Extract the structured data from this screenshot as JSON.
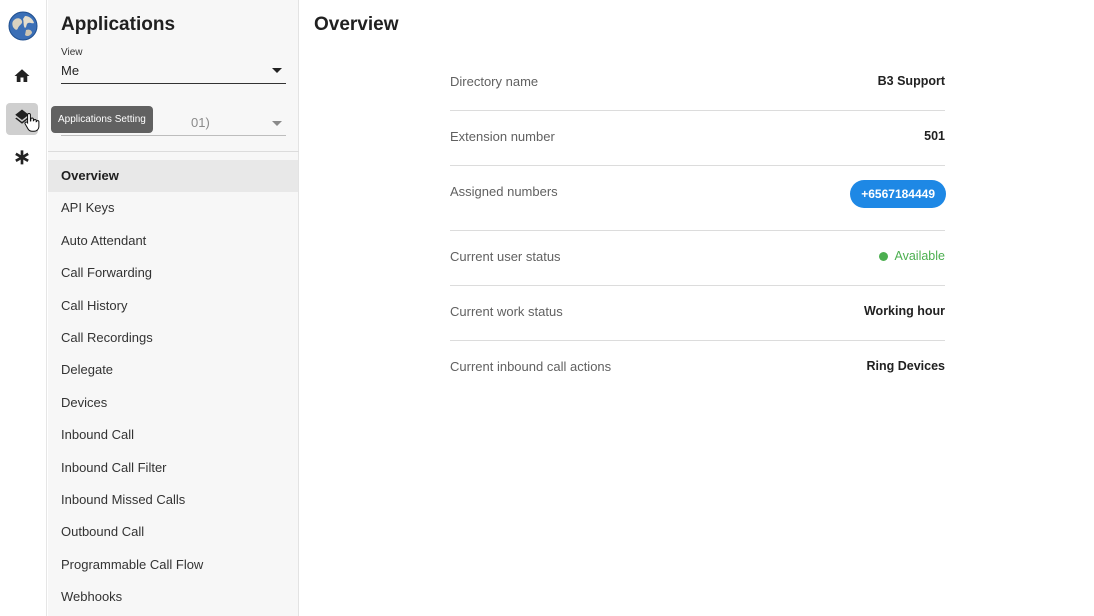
{
  "tooltip": "Applications Setting",
  "panel": {
    "title": "Applications",
    "view_label": "View",
    "view_value": "Me",
    "user_value": "01)",
    "menu": [
      "Overview",
      "API Keys",
      "Auto Attendant",
      "Call Forwarding",
      "Call History",
      "Call Recordings",
      "Delegate",
      "Devices",
      "Inbound Call",
      "Inbound Call Filter",
      "Inbound Missed Calls",
      "Outbound Call",
      "Programmable Call Flow",
      "Webhooks"
    ],
    "active_item": "Overview"
  },
  "main": {
    "title": "Overview",
    "rows": {
      "directory_name": {
        "label": "Directory name",
        "value": "B3 Support"
      },
      "extension_number": {
        "label": "Extension number",
        "value": "501"
      },
      "assigned_numbers": {
        "label": "Assigned numbers",
        "value": "+6567184449"
      },
      "user_status": {
        "label": "Current user status",
        "value": "Available"
      },
      "work_status": {
        "label": "Current work status",
        "value": "Working hour"
      },
      "inbound_actions": {
        "label": "Current inbound call actions",
        "value": "Ring Devices"
      }
    }
  },
  "icons": {
    "logo": "globe-logo-icon",
    "home": "home-icon",
    "applications": "layers-icon",
    "settings": "asterisk-icon"
  },
  "colors": {
    "accent": "#1e88e5",
    "available": "#4caf50"
  }
}
